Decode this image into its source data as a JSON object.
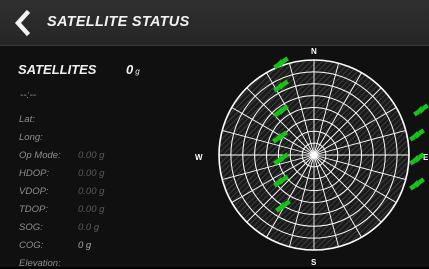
{
  "header": {
    "title": "SATELLITE STATUS",
    "back_icon": "chevron-left-icon"
  },
  "satellites": {
    "label": "SATELLITES",
    "count": "0",
    "unit": "g"
  },
  "time": "--:--",
  "fields": [
    {
      "label": "Lat:",
      "value": ""
    },
    {
      "label": "Long:",
      "value": ""
    },
    {
      "label": "Op Mode:",
      "value": "0.00 g"
    },
    {
      "label": "HDOP:",
      "value": "0.00 g"
    },
    {
      "label": "VDOP:",
      "value": "0.00 g"
    },
    {
      "label": "TDOP:",
      "value": "0.00 g"
    },
    {
      "label": "SOG:",
      "value": "0.0 g"
    },
    {
      "label": "COG:",
      "value": "0 g"
    },
    {
      "label": "Elevation:",
      "value": ""
    }
  ],
  "compass": {
    "north": "N",
    "south": "S",
    "east": "E",
    "west": "W"
  },
  "satellite_markers": [
    "green-satellite-icon"
  ],
  "colors": {
    "satellite": "#19c11b",
    "plot_lines": "#ffffff",
    "header_bg": "#2b2b2b"
  }
}
